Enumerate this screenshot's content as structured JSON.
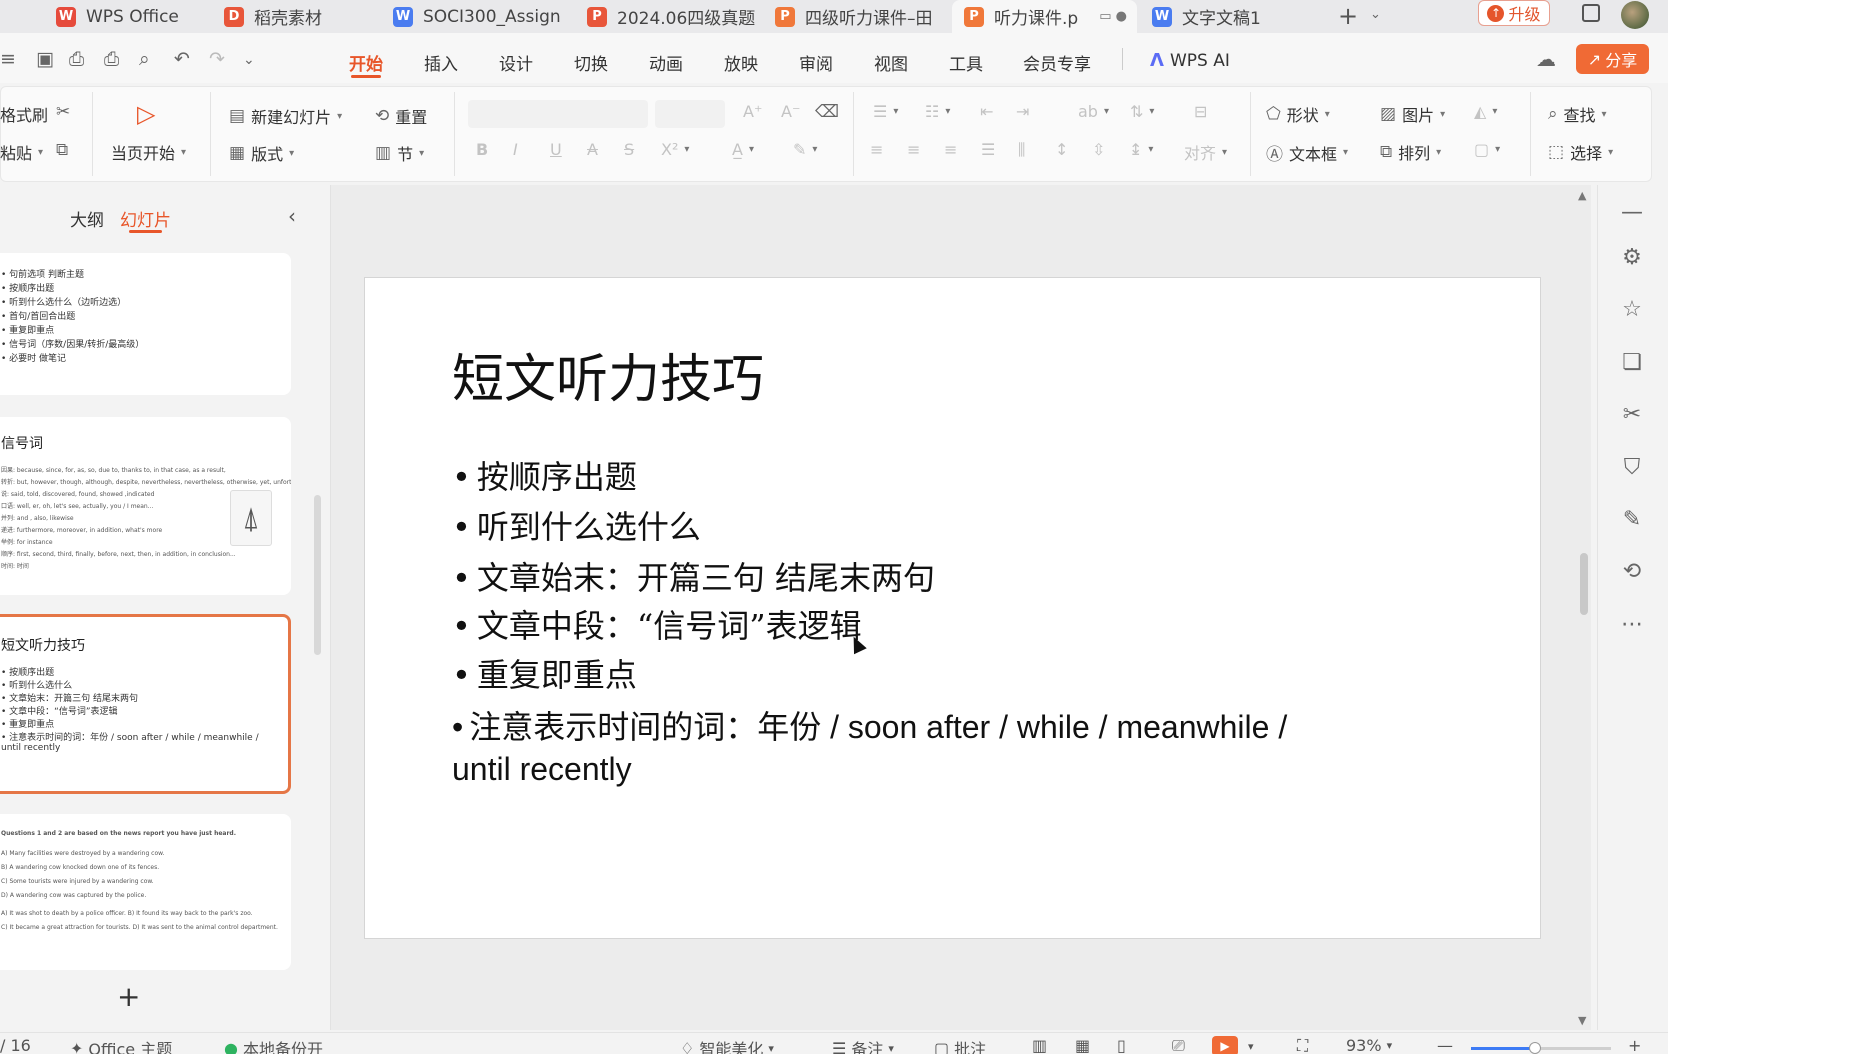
{
  "tabs": [
    {
      "label": "WPS Office",
      "icon": "W",
      "color": "#e64b3c"
    },
    {
      "label": "稻壳素材",
      "icon": "D",
      "color": "#e8563a"
    },
    {
      "label": "SOCI300_Assign",
      "icon": "W",
      "color": "#4a7cf0"
    },
    {
      "label": "2024.06四级真题",
      "icon": "P",
      "color": "#e8563a"
    },
    {
      "label": "四级听力课件–田",
      "icon": "P",
      "color": "#f0783a"
    },
    {
      "label": "听力课件.p",
      "icon": "P",
      "color": "#f0783a"
    },
    {
      "label": "文字文稿1",
      "icon": "W",
      "color": "#4a7cf0"
    }
  ],
  "header": {
    "upgrade_label": "升级",
    "share_label": "分享"
  },
  "menu": {
    "items": [
      "开始",
      "插入",
      "设计",
      "切换",
      "动画",
      "放映",
      "审阅",
      "视图",
      "工具",
      "会员专享"
    ],
    "active": "开始",
    "ai_label": "WPS AI"
  },
  "ribbon": {
    "format_painter": "格式刷",
    "paste": "粘贴",
    "play_from_current": "当页开始",
    "new_slide": "新建幻灯片",
    "reset": "重置",
    "layout": "版式",
    "section": "节",
    "align": "对齐",
    "shape": "形状",
    "picture": "图片",
    "find": "查找",
    "textbox": "文本框",
    "arrange": "排列",
    "select": "选择",
    "bold": "B",
    "italic": "I",
    "underline": "U",
    "strike": "A",
    "shadow": "S",
    "superscript": "X²",
    "grow_font": "A⁺",
    "shrink_font": "A⁻"
  },
  "left_pane": {
    "tab_outline": "大纲",
    "tab_slides": "幻灯片",
    "thumbs": [
      {
        "title": "",
        "lines": [
          "• 句前选项 判断主题",
          "• 按顺序出题",
          "• 听到什么选什么（边听边选）",
          "• 首句/首回合出题",
          "• 重复即重点",
          "• 信号词（序数/因果/转折/最高级）",
          "• 必要时 做笔记"
        ]
      },
      {
        "title": "信号词",
        "lines": [
          "因果: because, since, for, as, so, due to, thanks to, in that case, as a result,",
          "转折: but, however, though, although, despite, nevertheless, nevertheless, otherwise, yet, unfortunately",
          "说: said, told, discovered, found, showed ,indicated",
          "口语: well, er, oh, let's see, actually, you / I mean...",
          "并列: and , also, likewise",
          "递进: furthermore, moreover, in addition, what's more",
          "举例: for instance",
          "顺序: first, second, third, finally, before, next, then, in addition, in conclusion...",
          "时间: 时间"
        ]
      },
      {
        "title": "短文听力技巧",
        "lines": [
          "• 按顺序出题",
          "• 听到什么选什么",
          "• 文章始末：开篇三句 结尾末两句",
          "• 文章中段：“信号词”表逻辑",
          "• 重复即重点",
          "• 注意表示时间的词：年份 / soon after / while / meanwhile /",
          "until recently"
        ]
      },
      {
        "title": "",
        "lines": [
          "Questions 1 and 2 are based on the news report you have just heard.",
          "A) Many facilities were destroyed by a wandering cow.",
          "B) A wandering cow knocked down one of its fences.",
          "C) Some tourists were injured by a wandering cow.",
          "D) A wandering cow was captured by the police.",
          "A) It was shot to death by a police officer.        B) It found its way back to the park's zoo.",
          "C) It became a great attraction for tourists.       D) It was sent to the animal control department."
        ]
      }
    ]
  },
  "slide": {
    "title": "短文听力技巧",
    "bullets": [
      "按顺序出题",
      "听到什么选什么",
      "文章始末：开篇三句 结尾末两句",
      "文章中段：“信号词”表逻辑",
      "重复即重点",
      "注意表示时间的词：年份 / soon after / while / meanwhile /"
    ],
    "continuation": "until recently"
  },
  "status": {
    "page": "/ 16",
    "theme": "Office 主题",
    "backup": "本地备份开",
    "beautify": "智能美化",
    "notes": "备注",
    "comments": "批注",
    "zoom": "93%",
    "zoom_fraction": 0.46
  },
  "colors": {
    "accent": "#e8562a",
    "share": "#f06a35",
    "selected_border": "#e57646"
  }
}
